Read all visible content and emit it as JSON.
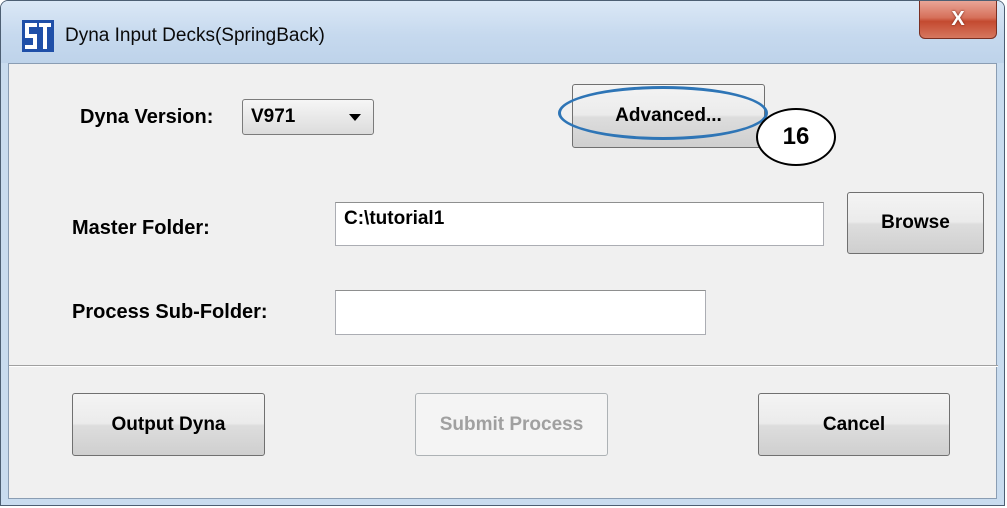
{
  "window": {
    "title": "Dyna Input Decks(SpringBack)",
    "close_glyph": "X"
  },
  "dyna_version": {
    "label": "Dyna Version:",
    "selected": "V971"
  },
  "advanced_button": {
    "label": "Advanced..."
  },
  "master_folder": {
    "label": "Master Folder:",
    "value": "C:\\tutorial1",
    "browse_label": "Browse"
  },
  "process_subfolder": {
    "label": "Process Sub-Folder:",
    "value": ""
  },
  "footer": {
    "output_label": "Output Dyna",
    "submit_label": "Submit Process",
    "cancel_label": "Cancel"
  },
  "annotation": {
    "callout_number": "16",
    "highlight_color": "#2e75b6"
  },
  "icons": {
    "app": "app-logo-icon",
    "dropdown": "chevron-down-icon"
  }
}
